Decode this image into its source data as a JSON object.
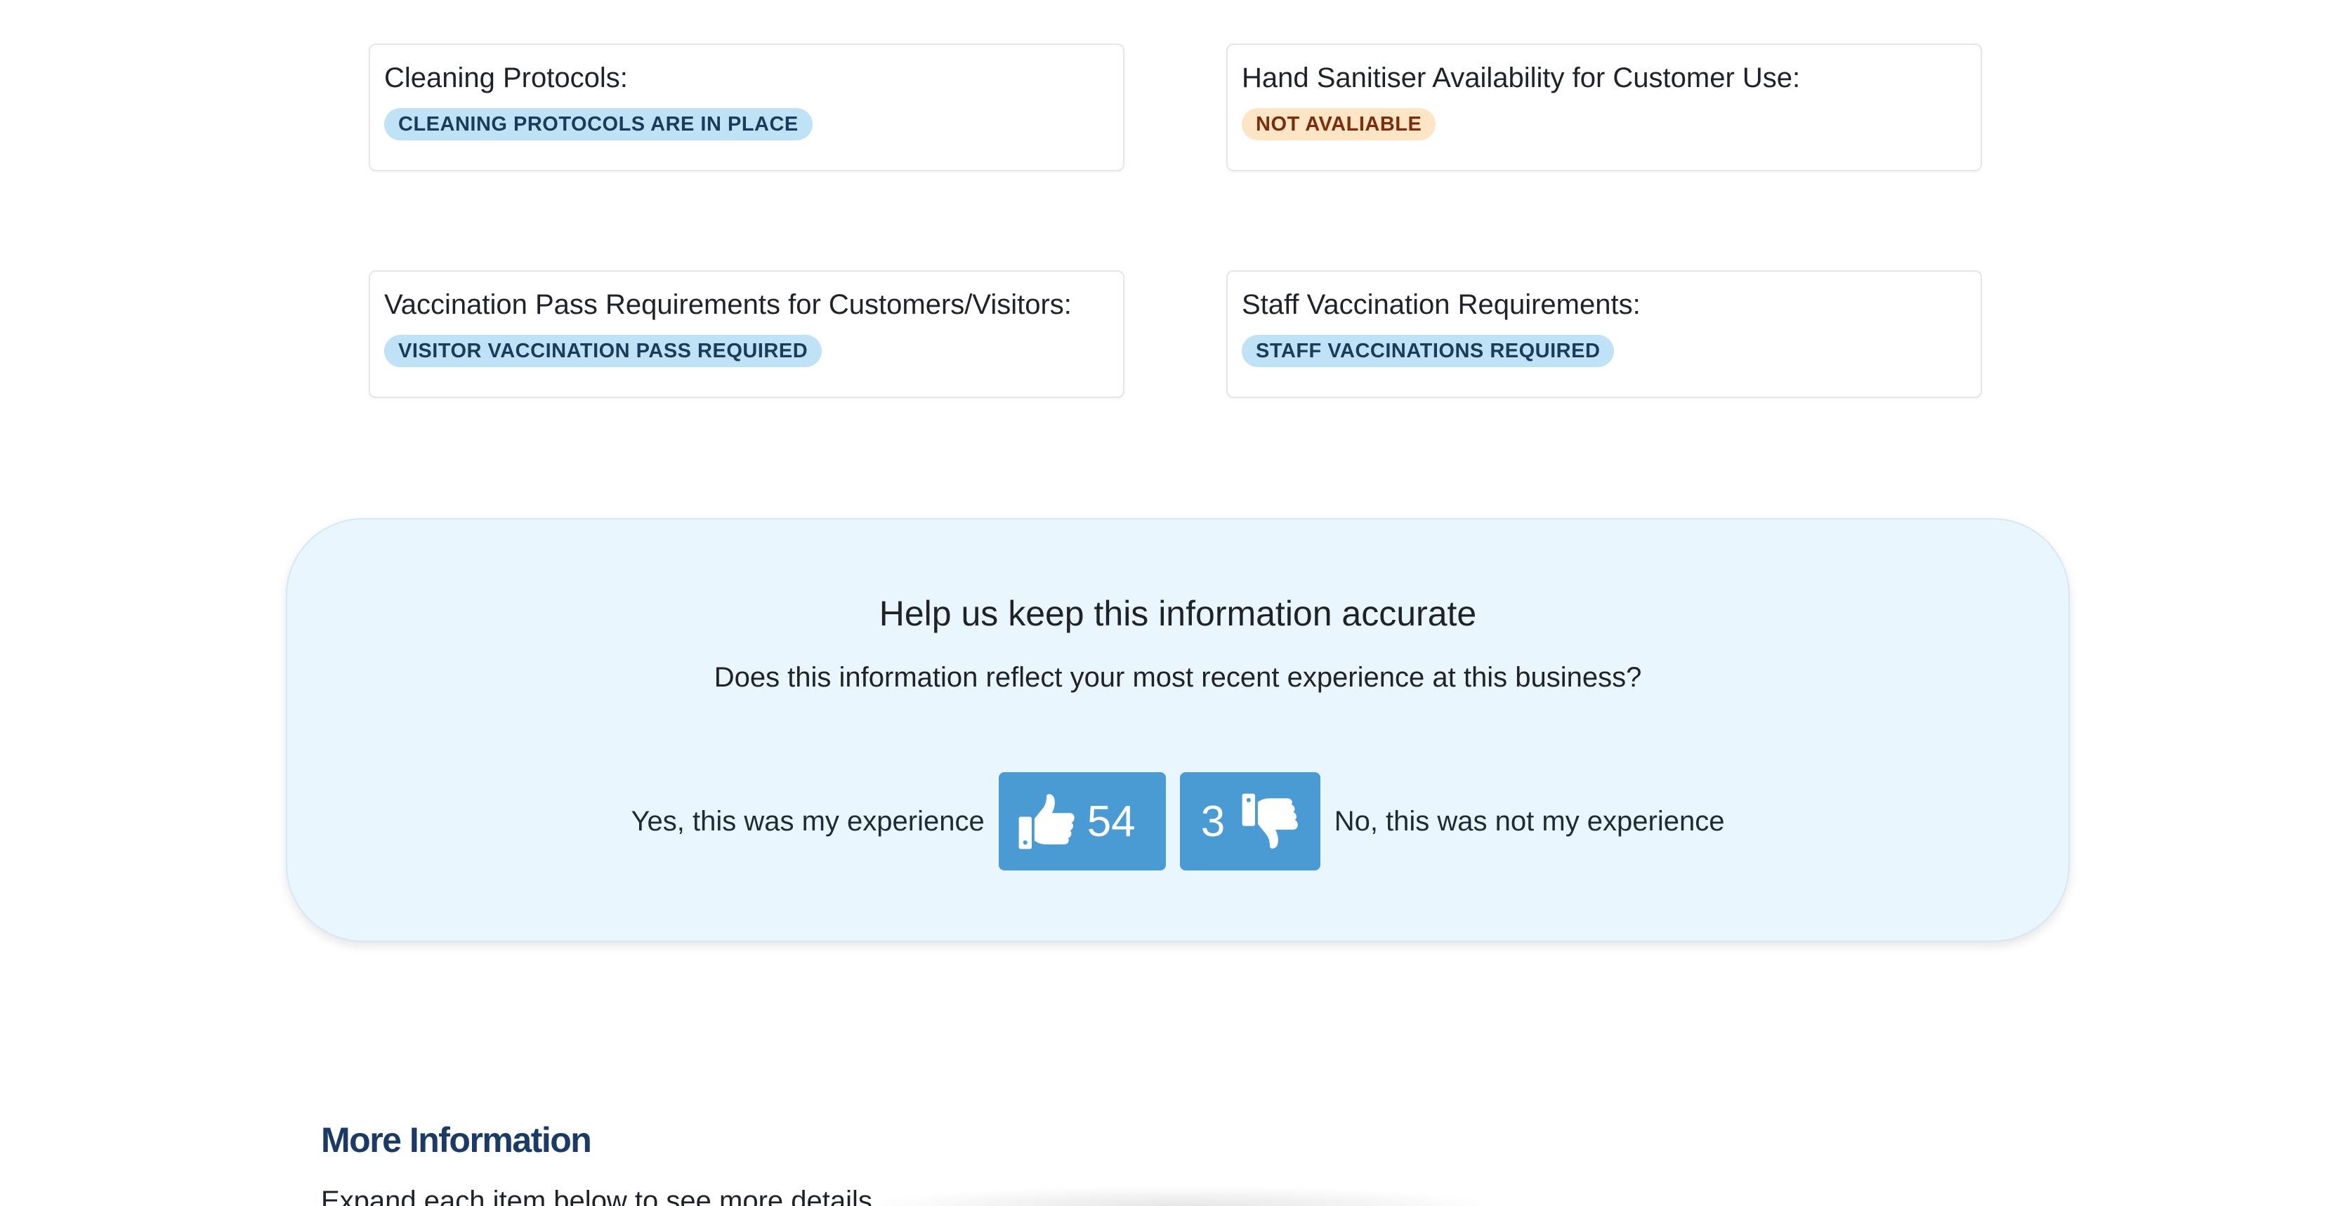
{
  "status_cards": [
    {
      "title": "Cleaning Protocols:",
      "badge": "CLEANING PROTOCOLS ARE IN PLACE",
      "badge_color": "#bfe2f7"
    },
    {
      "title": "Hand Sanitiser Availability for Customer Use:",
      "badge": "NOT AVALIABLE",
      "badge_color": "#fde5c6"
    },
    {
      "title": "Vaccination Pass Requirements for Customers/Visitors:",
      "badge": "VISITOR VACCINATION PASS REQUIRED",
      "badge_color": "#bfe2f7"
    },
    {
      "title": "Staff Vaccination Requirements:",
      "badge": "STAFF VACCINATIONS REQUIRED",
      "badge_color": "#bfe2f7"
    }
  ],
  "feedback": {
    "heading": "Help us keep this information accurate",
    "question": "Does this information reflect your most recent experience at this business?",
    "yes_label": "Yes, this was my experience",
    "yes_count": "54",
    "yes_icon": "thumbs-up-icon",
    "no_count": "3",
    "no_icon": "thumbs-down-icon",
    "no_label": "No, this was not my experience",
    "button_color": "#4a9bd4",
    "panel_color": "#eaf6fe"
  },
  "more_info": {
    "title": "More Information",
    "subtitle": "Expand each item below to see more details"
  }
}
